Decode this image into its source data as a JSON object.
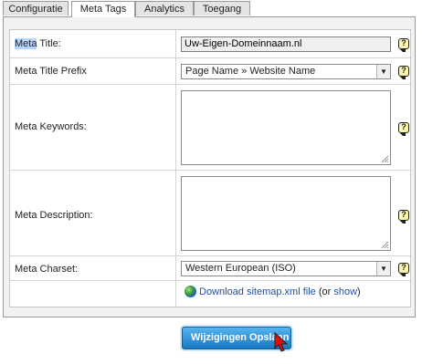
{
  "tabs": [
    {
      "label": "Configuratie",
      "active": false
    },
    {
      "label": "Meta Tags",
      "active": true
    },
    {
      "label": "Analytics",
      "active": false
    },
    {
      "label": "Toegang",
      "active": false
    }
  ],
  "form": {
    "meta_title": {
      "label_highlight": "Meta",
      "label_rest": " Title:",
      "value": "Uw-Eigen-Domeinnaam.nl"
    },
    "meta_title_prefix": {
      "label": "Meta Title Prefix",
      "value": "Page Name » Website Name"
    },
    "meta_keywords": {
      "label": "Meta Keywords:",
      "value": ""
    },
    "meta_description": {
      "label": "Meta Description:",
      "value": ""
    },
    "meta_charset": {
      "label": "Meta Charset:",
      "value": "Western European (ISO)"
    },
    "help_glyph": "?",
    "sitemap": {
      "link_text": "Download sitemap.xml file",
      "mid_text": " (or ",
      "show_text": "show",
      "end_text": ")"
    }
  },
  "save_button": {
    "label": "Wijzigingen Opslaan"
  },
  "icons": {
    "help": "help-question-icon",
    "globe": "globe-icon",
    "cursor": "mouse-pointer-icon",
    "dropdown": "chevron-down-icon"
  },
  "colors": {
    "button_top": "#55b3ee",
    "button_bottom": "#1878c4",
    "link": "#1f4fa8",
    "highlight": "#b5d5ff",
    "help_bg": "#fff8b0"
  }
}
